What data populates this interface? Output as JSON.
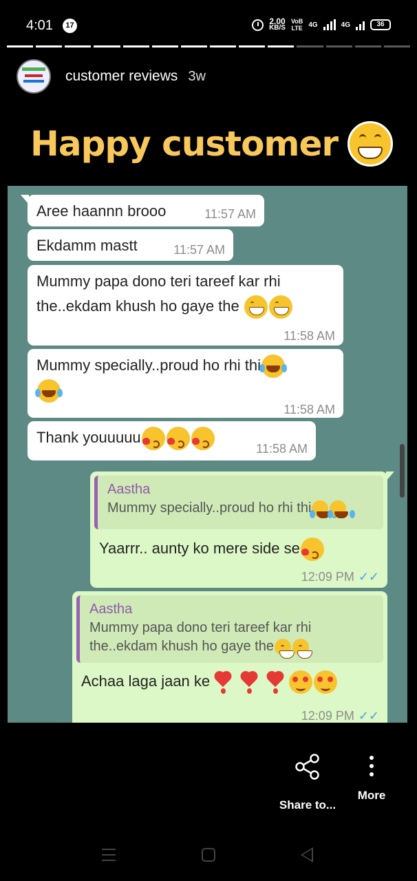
{
  "status_bar": {
    "time": "4:01",
    "notification_count": "17",
    "net_speed": "2.00",
    "net_unit": "KB/S",
    "volte": "VoB",
    "lte": "LTE",
    "net1": "4G",
    "net2": "4G",
    "battery": "36"
  },
  "story": {
    "username": "customer reviews",
    "age": "3w",
    "segments_total": 14,
    "segment_current": 10
  },
  "title": "Happy customer",
  "chat": {
    "messages": [
      {
        "text": "Aree haannn brooo",
        "time": "11:57 AM"
      },
      {
        "text": "Ekdamm mastt",
        "time": "11:57 AM"
      },
      {
        "text_line1": "Mummy papa dono teri tareef kar rhi",
        "text_line2": "the..ekdam khush ho gaye the",
        "time": "11:58 AM"
      },
      {
        "text": "Mummy specially..proud ho rhi thi",
        "time": "11:58 AM"
      },
      {
        "text": "Thank youuuuu",
        "time": "11:58 AM"
      },
      {
        "quote_name": "Aastha",
        "quote_text": "Mummy specially..proud ho rhi thi",
        "text": "Yaarrr.. aunty ko mere side se",
        "time": "12:09 PM"
      },
      {
        "quote_name": "Aastha",
        "quote_line1": "Mummy papa dono teri tareef kar rhi",
        "quote_line2": "the..ekdam khush ho gaye the",
        "text": "Achaa laga jaan ke",
        "time": "12:09 PM"
      }
    ]
  },
  "actions": {
    "share_label": "Share to...",
    "more_label": "More"
  },
  "icons": [
    "alarm-icon",
    "signal-icon",
    "battery-icon",
    "share-icon",
    "more-icon",
    "menu-icon",
    "home-icon",
    "back-icon",
    "grin-emoji-icon",
    "joy-emoji-icon",
    "kiss-emoji-icon",
    "heart-emoji-icon",
    "love-emoji-icon",
    "read-ticks-icon"
  ],
  "colors": {
    "title": "#f9c85a",
    "chat_bg": "#5d8a84",
    "incoming": "#ffffff",
    "outgoing": "#dcf8c6",
    "quote_name": "#8e5aa8",
    "ticks": "#4fa3e0"
  }
}
